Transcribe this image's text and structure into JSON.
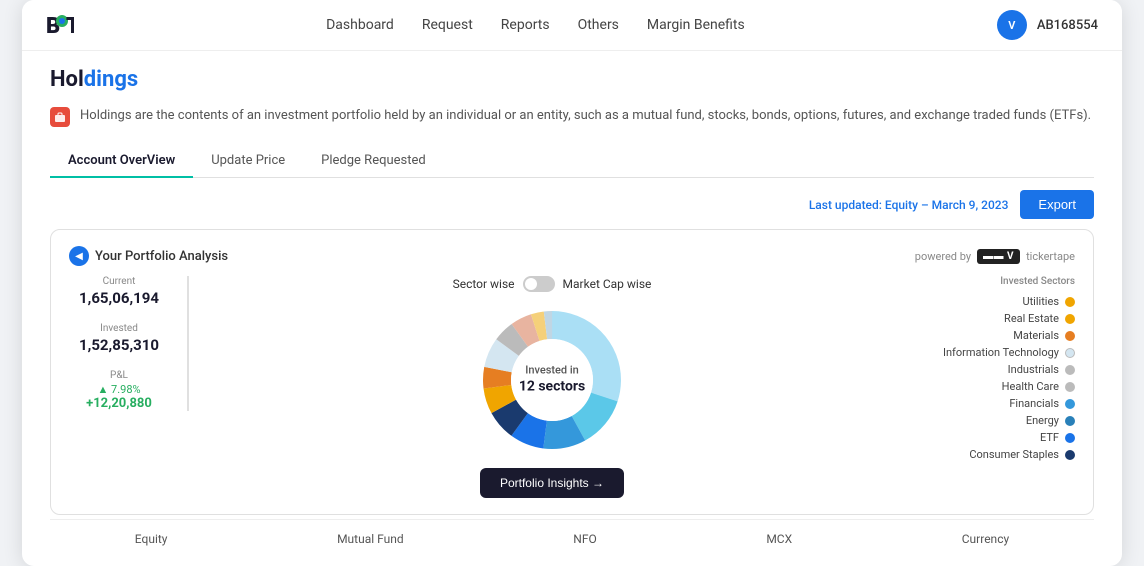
{
  "app": {
    "logo_text_b": "B",
    "logo_text_t": "T"
  },
  "nav": {
    "items": [
      {
        "id": "dashboard",
        "label": "Dashboard"
      },
      {
        "id": "request",
        "label": "Request"
      },
      {
        "id": "reports",
        "label": "Reports"
      },
      {
        "id": "others",
        "label": "Others"
      },
      {
        "id": "margin-benefits",
        "label": "Margin Benefits"
      }
    ]
  },
  "user": {
    "avatar_initials": "V",
    "user_id": "AB168554"
  },
  "page": {
    "title_prefix": "Hol",
    "title_suffix": "dings",
    "info_text": "Holdings are the contents of an investment portfolio held by an individual or an entity, such as a mutual fund, stocks, bonds, options, futures, and exchange traded funds (ETFs)."
  },
  "tabs": [
    {
      "id": "account-overview",
      "label": "Account OverView",
      "active": true
    },
    {
      "id": "update-price",
      "label": "Update Price",
      "active": false
    },
    {
      "id": "pledge-requested",
      "label": "Pledge Requested",
      "active": false
    }
  ],
  "toolbar": {
    "last_updated_label": "Last updated: Equity –",
    "last_updated_date": "March 9, 2023",
    "export_label": "Export"
  },
  "portfolio": {
    "nav_label": "Your Portfolio Analysis",
    "powered_by": "powered by",
    "tickertape_label": "tickertape",
    "current_label": "Current",
    "current_value": "1,65,06,194",
    "invested_label": "Invested",
    "invested_value": "1,52,85,310",
    "pnl_label": "P&L",
    "pnl_pct": "▲ 7.98%",
    "pnl_value": "+12,20,880",
    "sector_wise_label": "Sector wise",
    "market_cap_wise_label": "Market Cap wise",
    "donut_center_line1": "Invested in",
    "donut_center_line2": "12 sectors",
    "insights_btn_label": "Portfolio Insights →",
    "legend_title": "Invested Sectors",
    "sectors": [
      {
        "name": "Utilities",
        "color": "#f0a500"
      },
      {
        "name": "Real Estate",
        "color": "#f0a500"
      },
      {
        "name": "Materials",
        "color": "#e67e22"
      },
      {
        "name": "Information Technology",
        "color": "#d4e6f1"
      },
      {
        "name": "Industrials",
        "color": "#aaa"
      },
      {
        "name": "Health Care",
        "color": "#aaa"
      },
      {
        "name": "Financials",
        "color": "#3498db"
      },
      {
        "name": "Energy",
        "color": "#2980b9"
      },
      {
        "name": "ETF",
        "color": "#1a73e8"
      },
      {
        "name": "Consumer Staples",
        "color": "#1a3a6e"
      }
    ],
    "donut_segments": [
      {
        "color": "#aadff5",
        "pct": 30
      },
      {
        "color": "#5bc8e8",
        "pct": 12
      },
      {
        "color": "#3498db",
        "pct": 10
      },
      {
        "color": "#1a73e8",
        "pct": 8
      },
      {
        "color": "#1a3a6e",
        "pct": 7
      },
      {
        "color": "#f0a500",
        "pct": 6
      },
      {
        "color": "#e67e22",
        "pct": 5
      },
      {
        "color": "#d4e6f1",
        "pct": 7
      },
      {
        "color": "#aaa",
        "pct": 5
      },
      {
        "color": "#e8b4a0",
        "pct": 5
      },
      {
        "color": "#f5d07a",
        "pct": 3
      },
      {
        "color": "#c0d6e4",
        "pct": 2
      }
    ]
  },
  "bottom_tabs": [
    {
      "id": "equity",
      "label": "Equity"
    },
    {
      "id": "mutual-fund",
      "label": "Mutual Fund"
    },
    {
      "id": "nfo",
      "label": "NFO"
    },
    {
      "id": "mcx",
      "label": "MCX"
    },
    {
      "id": "currency",
      "label": "Currency"
    }
  ]
}
